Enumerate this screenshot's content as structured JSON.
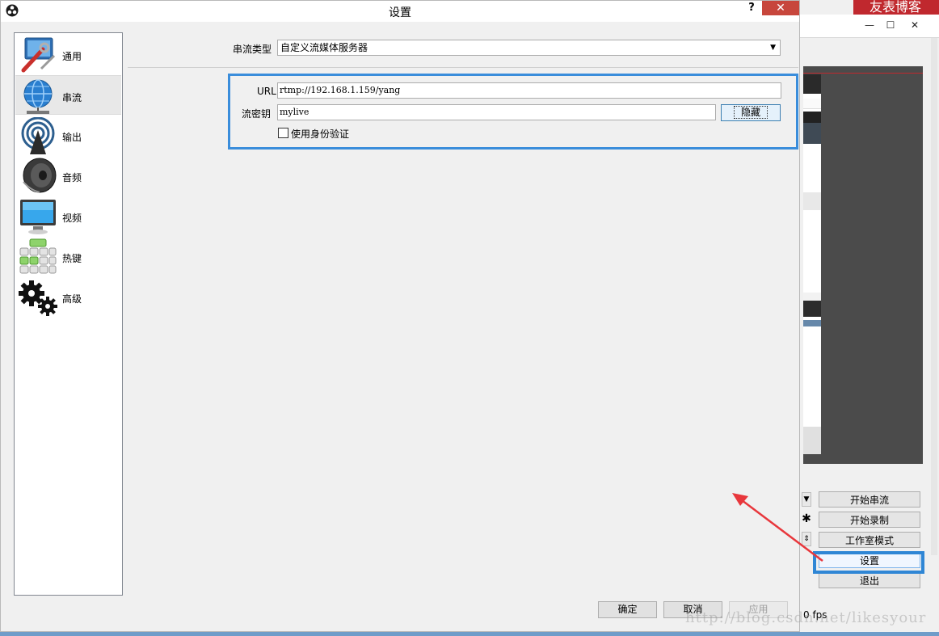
{
  "dialog": {
    "title": "设置",
    "help_label": "?",
    "close_label": "✕"
  },
  "sidebar": {
    "items": [
      {
        "label": "通用",
        "icon": "general-tools-icon"
      },
      {
        "label": "串流",
        "icon": "globe-network-icon",
        "active": true
      },
      {
        "label": "输出",
        "icon": "broadcast-antenna-icon"
      },
      {
        "label": "音频",
        "icon": "speaker-icon"
      },
      {
        "label": "视频",
        "icon": "monitor-icon"
      },
      {
        "label": "热键",
        "icon": "keyboard-icon"
      },
      {
        "label": "高级",
        "icon": "gears-icon"
      }
    ]
  },
  "stream": {
    "type_label": "串流类型",
    "type_value": "自定义流媒体服务器",
    "url_label": "URL",
    "url_value": "rtmp://192.168.1.159/yang",
    "key_label": "流密钥",
    "key_value": "mylive",
    "hide_button": "隐藏",
    "auth_label": "使用身份验证",
    "auth_checked": false
  },
  "buttons": {
    "ok": "确定",
    "cancel": "取消",
    "apply": "应用"
  },
  "main_window": {
    "banner_text": "友表博客",
    "controls": {
      "start_stream": "开始串流",
      "start_record": "开始录制",
      "studio_mode": "工作室模式",
      "settings": "设置",
      "exit": "退出"
    },
    "status_text": "0 fps"
  },
  "watermark": "http://blog.csdn.net/likesyour",
  "colors": {
    "highlight_blue": "#3a8ddb",
    "arrow_red": "#e8373c",
    "close_red": "#c7463c",
    "banner_red": "#c0282e"
  }
}
